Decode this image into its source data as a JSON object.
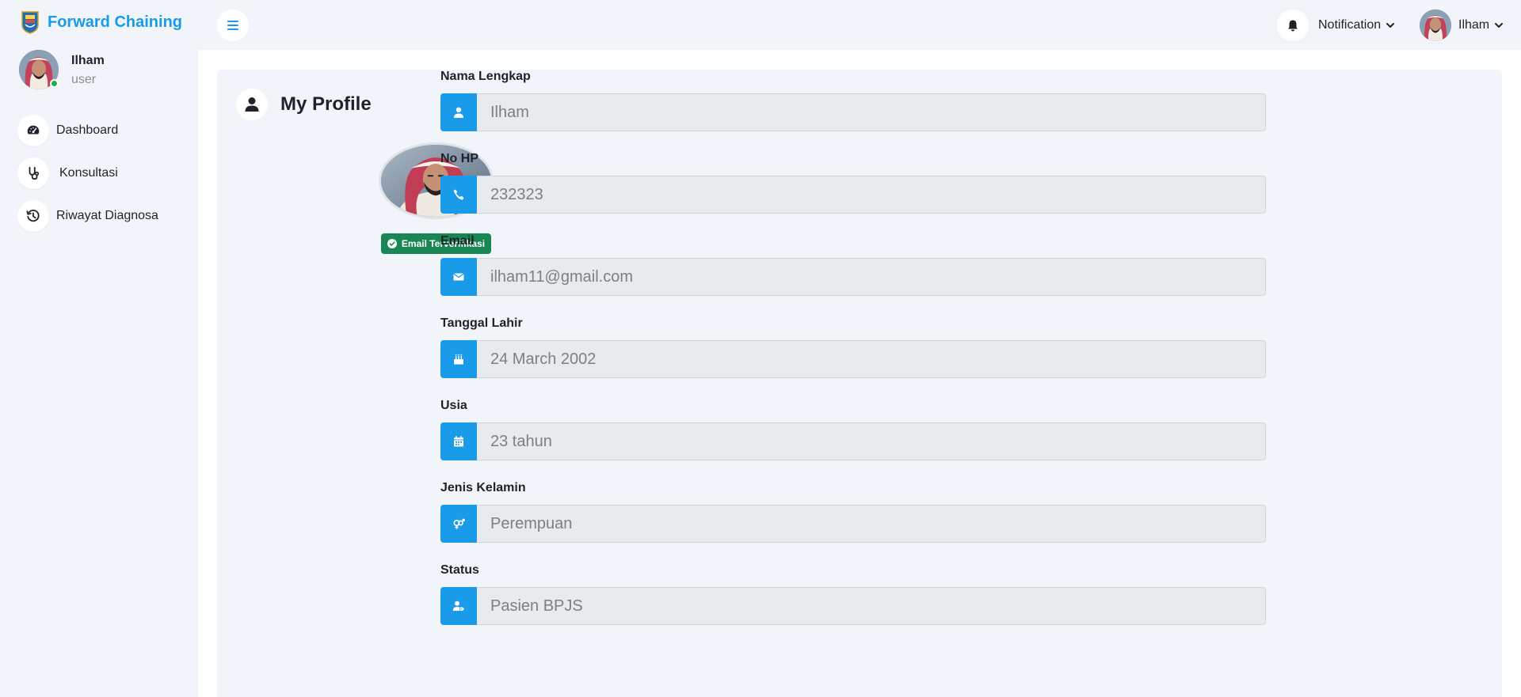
{
  "brand": {
    "name": "Forward Chaining",
    "logo_icon": "regional-emblem-icon",
    "color": "#1a9bea"
  },
  "sidebar": {
    "user": {
      "name": "Ilham",
      "role": "user",
      "online": true
    },
    "items": [
      {
        "label": "Dashboard",
        "icon": "gauge-icon"
      },
      {
        "label": "Konsultasi",
        "icon": "stethoscope-icon"
      },
      {
        "label": "Riwayat Diagnosa",
        "icon": "history-icon"
      }
    ]
  },
  "topbar": {
    "menu_icon": "hamburger-icon",
    "notification": {
      "label": "Notification",
      "icon": "bell-icon"
    },
    "profile": {
      "label": "Ilham"
    }
  },
  "page": {
    "title": "My Profile",
    "title_icon": "user-icon",
    "verified_badge": "Email Terverifikasi",
    "badge_color": "#198754"
  },
  "form": {
    "fields": [
      {
        "label": "Nama Lengkap",
        "value": "Ilham",
        "icon": "user-icon"
      },
      {
        "label": "No HP",
        "value": "232323",
        "icon": "phone-icon"
      },
      {
        "label": "Email",
        "value": "ilham11@gmail.com",
        "icon": "envelope-icon"
      },
      {
        "label": "Tanggal Lahir",
        "value": "24 March 2002",
        "icon": "birthday-cake-icon"
      },
      {
        "label": "Usia",
        "value": "23 tahun",
        "icon": "calendar-icon"
      },
      {
        "label": "Jenis Kelamin",
        "value": "Perempuan",
        "icon": "gender-icon"
      },
      {
        "label": "Status",
        "value": "Pasien BPJS",
        "icon": "user-tag-icon"
      }
    ]
  },
  "colors": {
    "accent": "#1a9bea",
    "background": "#f1f4f8",
    "input_bg": "#e8ebee",
    "online": "#22b04a"
  }
}
